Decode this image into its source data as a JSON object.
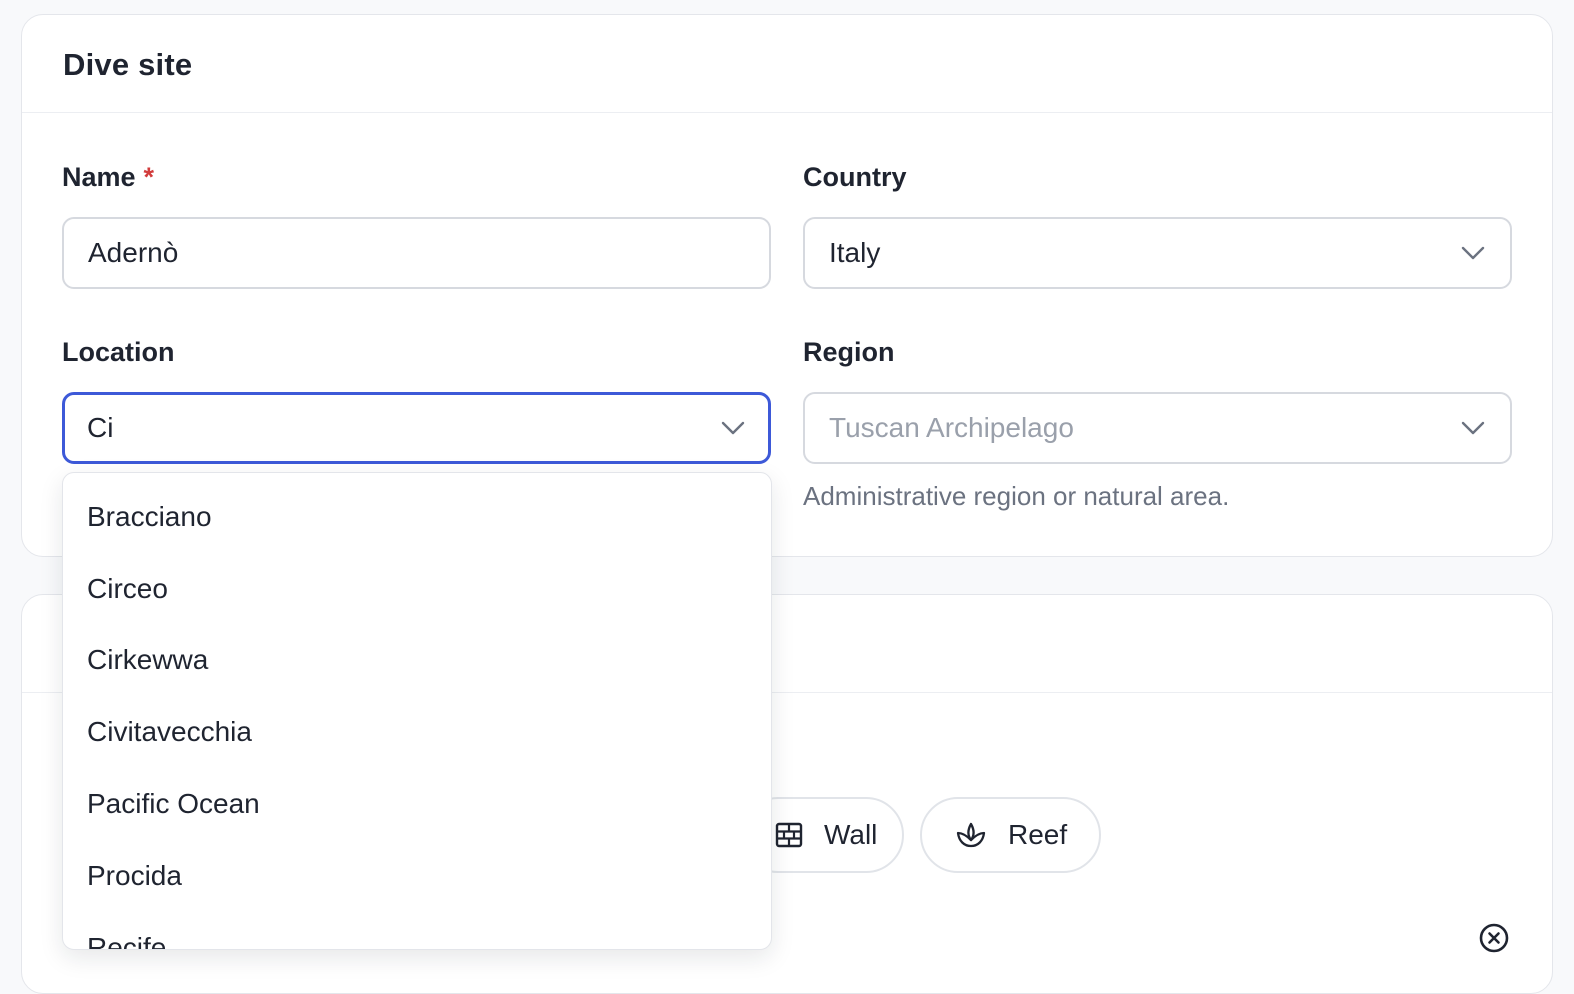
{
  "section_dive_site": {
    "title": "Dive site"
  },
  "form": {
    "name": {
      "label": "Name",
      "required_mark": "*",
      "value": "Adernò"
    },
    "country": {
      "label": "Country",
      "value": "Italy"
    },
    "location": {
      "label": "Location",
      "value": "Ci"
    },
    "region": {
      "label": "Region",
      "placeholder": "Tuscan Archipelago",
      "hint": "Administrative region or natural area."
    }
  },
  "location_dropdown": {
    "options": [
      "Bracciano",
      "Circeo",
      "Cirkewwa",
      "Civitavecchia",
      "Pacific Ocean",
      "Procida",
      "Recife"
    ]
  },
  "site_types": {
    "chips": [
      {
        "label": "Wall",
        "icon": "wall-icon"
      },
      {
        "label": "Reef",
        "icon": "reef-icon"
      }
    ]
  },
  "colors": {
    "focus_border": "#3d59d8",
    "required": "#d23c3c",
    "hint_text": "#6b7280",
    "placeholder_text": "#9aa0ab"
  }
}
